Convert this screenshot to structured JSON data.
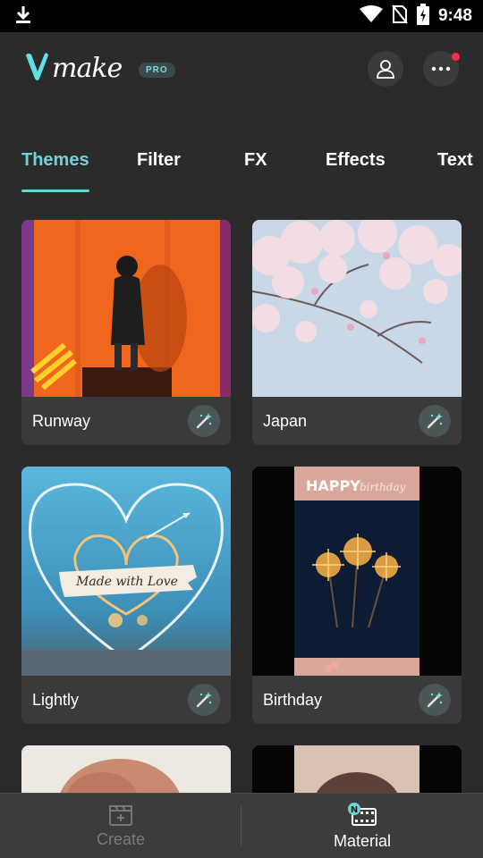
{
  "status_bar": {
    "time": "9:48",
    "icons": [
      "download-icon",
      "wifi-icon",
      "no-sim-icon",
      "battery-charging-icon"
    ]
  },
  "header": {
    "logo_text": "make",
    "pro_badge": "PRO",
    "notification_color": "#ff2d4b"
  },
  "tabs": [
    {
      "label": "Themes",
      "active": true
    },
    {
      "label": "Filter",
      "active": false
    },
    {
      "label": "FX",
      "active": false
    },
    {
      "label": "Effects",
      "active": false
    },
    {
      "label": "Text",
      "active": false
    }
  ],
  "accent_color": "#6ed3d6",
  "cards": [
    {
      "title": "Runway",
      "action_icon": "magic-wand-icon"
    },
    {
      "title": "Japan",
      "action_icon": "magic-wand-icon"
    },
    {
      "title": "Lightly",
      "action_icon": "magic-wand-icon",
      "thumb_text": "Made with Love"
    },
    {
      "title": "Birthday",
      "action_icon": "magic-wand-icon",
      "thumb_text_1": "HAPPY",
      "thumb_text_2": "birthday"
    },
    {
      "title": "",
      "action_icon": ""
    },
    {
      "title": "",
      "action_icon": ""
    }
  ],
  "bottom_nav": [
    {
      "label": "Create",
      "icon": "clapperboard-plus-icon",
      "active": false
    },
    {
      "label": "Material",
      "icon": "film-material-icon",
      "badge": "N",
      "active": true
    }
  ]
}
